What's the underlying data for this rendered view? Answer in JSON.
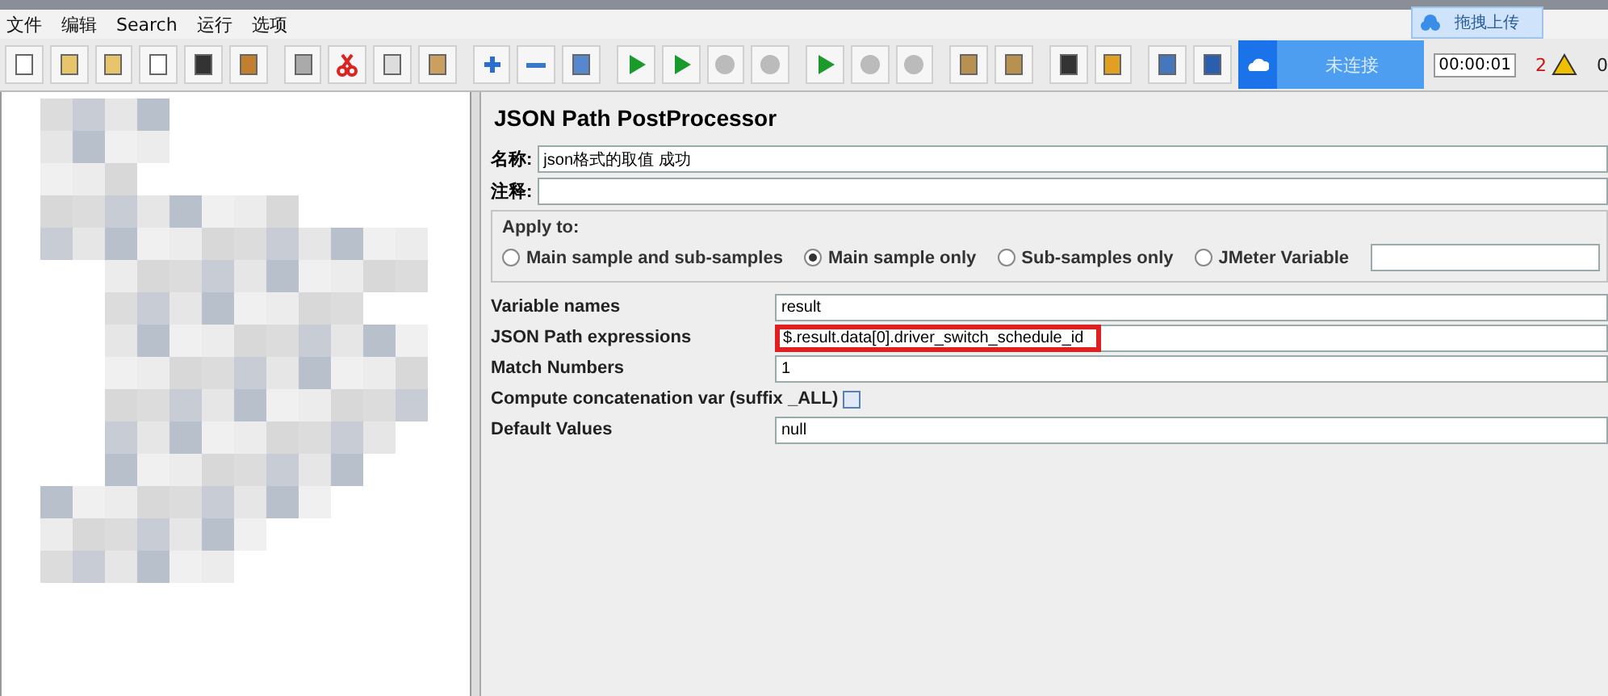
{
  "menu": [
    "文件",
    "编辑",
    "Search",
    "运行",
    "选项"
  ],
  "status": {
    "timer": "00:00:01",
    "warning_count": "2",
    "error_count": "0"
  },
  "upload_popup": {
    "connection": "未连接",
    "label": "拖拽上传"
  },
  "panel": {
    "title": "JSON Path PostProcessor",
    "name_label": "名称:",
    "name_value": "json格式的取值 成功",
    "comment_label": "注释:",
    "apply_to": {
      "legend": "Apply to:",
      "options": [
        {
          "label": "Main sample and sub-samples",
          "selected": false
        },
        {
          "label": "Main sample only",
          "selected": true
        },
        {
          "label": "Sub-samples only",
          "selected": false
        },
        {
          "label": "JMeter Variable",
          "selected": false
        }
      ]
    },
    "fields": [
      {
        "kind": "text",
        "label": "Variable names",
        "value": "result",
        "highlighted": false
      },
      {
        "kind": "text",
        "label": "JSON Path expressions",
        "value": "$.result.data[0].driver_switch_schedule_id",
        "highlighted": true
      },
      {
        "kind": "text",
        "label": "Match Numbers",
        "value": "1",
        "highlighted": false
      },
      {
        "kind": "checkbox",
        "label": "Compute concatenation var (suffix _ALL)",
        "checked": false
      },
      {
        "kind": "text",
        "label": "Default Values",
        "value": "null",
        "highlighted": false
      }
    ]
  }
}
